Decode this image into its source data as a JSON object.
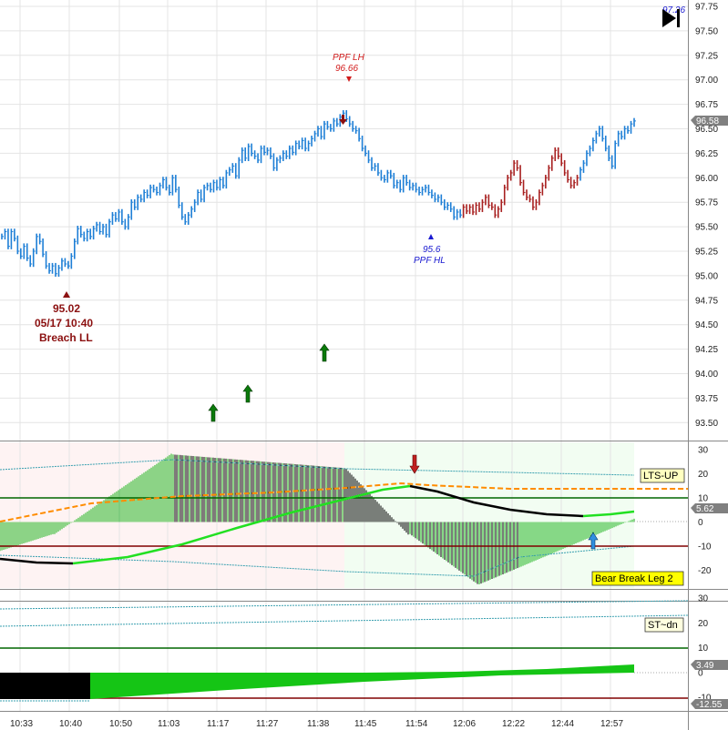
{
  "chart_data": {
    "type": "line",
    "panels": [
      {
        "name": "price",
        "y_ticks": [
          "97.75",
          "97.50",
          "97.25",
          "97.00",
          "96.75",
          "96.50",
          "96.25",
          "96.00",
          "95.75",
          "95.50",
          "95.25",
          "95.00",
          "94.75",
          "94.50",
          "94.25",
          "94.00",
          "93.75",
          "93.50"
        ],
        "last_value": "96.58",
        "top_label": "97.26",
        "ylim": [
          93.35,
          97.82
        ],
        "series": [
          {
            "color": "#1e7fd6",
            "x": [
              0,
              3,
              6,
              9,
              12,
              15,
              18,
              21,
              24,
              27,
              30,
              33,
              36,
              39,
              42,
              45,
              48,
              51,
              54,
              57,
              60,
              63,
              66,
              69,
              72,
              75,
              78,
              81,
              84,
              87,
              90,
              93,
              96,
              99,
              102,
              105,
              108,
              111,
              114,
              117,
              120,
              123,
              126,
              129,
              132,
              135,
              138,
              141,
              144,
              147,
              150,
              153,
              156,
              159,
              162,
              165,
              168,
              171,
              174,
              177,
              180,
              183,
              186,
              189,
              192,
              195,
              198,
              201,
              204,
              207,
              210,
              213,
              216,
              219,
              222,
              225,
              228,
              231,
              234,
              237,
              240,
              243,
              246,
              249,
              252,
              255,
              258,
              261,
              264,
              267,
              270,
              273,
              276,
              279,
              282,
              285,
              288,
              291,
              294,
              297,
              300,
              303,
              306,
              309,
              312,
              315,
              318,
              321,
              324,
              327,
              330,
              333,
              336,
              339,
              342,
              345,
              348,
              351,
              354,
              357,
              360,
              363,
              366,
              369,
              372,
              375,
              378,
              381,
              384,
              387,
              390,
              393,
              396,
              399,
              402,
              405,
              408,
              411,
              414,
              417,
              420,
              423,
              426,
              429,
              432,
              435,
              438,
              441,
              444,
              447
            ],
            "y": [
              95.4,
              95.45,
              95.3,
              95.45,
              95.38,
              95.25,
              95.2,
              95.3,
              95.18,
              95.12,
              95.25,
              95.4,
              95.35,
              95.22,
              95.1,
              95.05,
              95.1,
              95.02,
              95.08,
              95.15,
              95.12,
              95.1,
              95.2,
              95.35,
              95.48,
              95.42,
              95.38,
              95.45,
              95.4,
              95.48,
              95.52,
              95.45,
              95.5,
              95.42,
              95.55,
              95.62,
              95.58,
              95.65,
              95.55,
              95.5,
              95.6,
              95.75,
              95.7,
              95.8,
              95.78,
              95.85,
              95.82,
              95.9,
              95.88,
              95.85,
              95.92,
              95.98,
              95.9,
              95.85,
              96.0,
              95.88,
              95.72,
              95.6,
              95.55,
              95.62,
              95.68,
              95.75,
              95.85,
              95.78,
              95.9,
              95.92,
              95.88,
              95.95,
              95.9,
              95.98,
              95.92,
              96.05,
              96.08,
              96.12,
              96.02,
              96.18,
              96.28,
              96.2,
              96.32,
              96.25,
              96.22,
              96.18,
              96.3,
              96.26,
              96.28,
              96.22,
              96.1,
              96.18,
              96.2,
              96.25,
              96.22,
              96.3,
              96.26,
              96.35,
              96.32,
              96.38,
              96.3,
              96.35,
              96.4,
              96.45,
              96.5,
              96.42,
              96.55,
              96.52,
              96.5,
              96.58,
              96.55,
              96.62,
              96.66,
              96.6,
              96.55,
              96.5,
              96.48,
              96.4,
              96.3,
              96.25,
              96.18,
              96.1,
              96.12,
              96.05,
              96.0,
              95.98,
              96.05,
              96.02,
              95.92,
              95.95,
              95.88,
              96.0,
              95.95,
              95.9,
              95.92,
              95.88,
              95.85,
              95.88,
              95.9,
              95.85,
              95.82,
              95.78,
              95.8,
              95.75,
              95.7,
              95.72,
              95.68,
              95.6,
              95.65,
              95.62,
              95.7,
              95.66
            ]
          }
        ]
      },
      {
        "name": "oscillator",
        "y_ticks": [
          "30",
          "20",
          "10",
          "0",
          "-10",
          "-20"
        ],
        "last_value": "5.62",
        "ylim": [
          -28,
          32
        ]
      },
      {
        "name": "lower",
        "y_ticks": [
          "30",
          "20",
          "10",
          "0",
          "-10"
        ],
        "last_value": "3.49",
        "last_value_2": "-12.55",
        "ylim": [
          -12.55,
          32
        ]
      }
    ],
    "x_ticks": [
      "10:33",
      "10:40",
      "10:50",
      "11:03",
      "11:17",
      "11:27",
      "11:38",
      "11:45",
      "11:54",
      "12:06",
      "12:22",
      "12:44",
      "12:57"
    ]
  },
  "annotations": {
    "ppf_lh_label": "PPF LH",
    "ppf_lh_value": "96.66",
    "ppf_hl_value": "95.6",
    "ppf_hl_label": "PPF HL",
    "breach_value": "95.02",
    "breach_date": "05/17  10:40",
    "breach_label": "Breach LL"
  },
  "labels": {
    "lts_up": "LTS-UP",
    "bear_break": "Bear Break Leg 2",
    "st_dn": "ST~dn"
  },
  "colors": {
    "price_up": "#1e7fd6",
    "price_down": "#a82020",
    "hist_green": "#19b319",
    "hist_black": "#000000",
    "line_green": "#22e022",
    "dash_orange": "#ff8c00",
    "level_green": "#006600",
    "level_maroon": "#800000"
  },
  "icons": {
    "play_icon": "play-end-icon",
    "up_arrow": "up-arrow-icon",
    "down_arrow": "down-arrow-icon"
  }
}
